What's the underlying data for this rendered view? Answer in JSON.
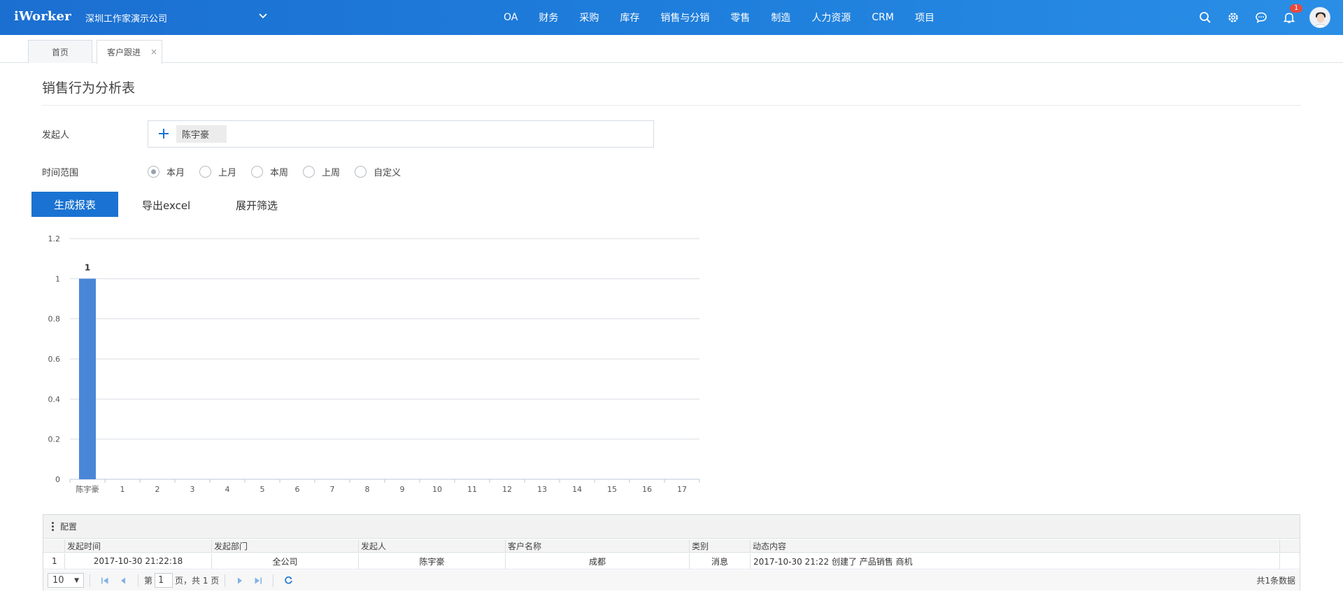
{
  "app": {
    "logo": "iWorker",
    "company": "深圳工作家演示公司"
  },
  "nav": [
    "OA",
    "财务",
    "采购",
    "库存",
    "销售与分销",
    "零售",
    "制造",
    "人力资源",
    "CRM",
    "项目"
  ],
  "notifications": {
    "count": "1"
  },
  "tabs": [
    {
      "label": "首页"
    },
    {
      "label": "客户跟进",
      "close": "×"
    }
  ],
  "page": {
    "title": "销售行为分析表",
    "initiator_label": "发起人",
    "initiator_value": "陈宇豪",
    "time_label": "时间范围",
    "time_options": [
      "本月",
      "上月",
      "本周",
      "上周",
      "自定义"
    ],
    "time_selected": "本月",
    "generate_btn": "生成报表",
    "export_btn": "导出excel",
    "filter_btn": "展开筛选"
  },
  "chart_data": {
    "type": "bar",
    "categories": [
      "陈宇豪",
      "1",
      "2",
      "3",
      "4",
      "5",
      "6",
      "7",
      "8",
      "9",
      "10",
      "11",
      "12",
      "13",
      "14",
      "15",
      "16",
      "17"
    ],
    "values": [
      1,
      null,
      null,
      null,
      null,
      null,
      null,
      null,
      null,
      null,
      null,
      null,
      null,
      null,
      null,
      null,
      null,
      null
    ],
    "data_labels": [
      "1"
    ],
    "yticks": [
      "0",
      "0.2",
      "0.4",
      "0.6",
      "0.8",
      "1",
      "1.2"
    ],
    "ylim": [
      0,
      1.2
    ],
    "grid": true,
    "bar_color": "#4a86d8"
  },
  "grid": {
    "toolbar_label": "配置",
    "columns": [
      "",
      "发起时间",
      "发起部门",
      "发起人",
      "客户名称",
      "类别",
      "动态内容"
    ],
    "rows": [
      [
        "1",
        "2017-10-30 21:22:18",
        "全公司",
        "陈宇豪",
        "成都",
        "消息",
        "2017-10-30 21:22 创建了 产品销售 商机"
      ]
    ],
    "page_size": "10",
    "page_prefix": "第",
    "page_number": "1",
    "page_suffix": "页，共 1 页",
    "total": "共1条数据"
  },
  "colors": {
    "header": "#1f7fdc",
    "primary": "#1a73d2",
    "bar": "#4a86d8"
  }
}
